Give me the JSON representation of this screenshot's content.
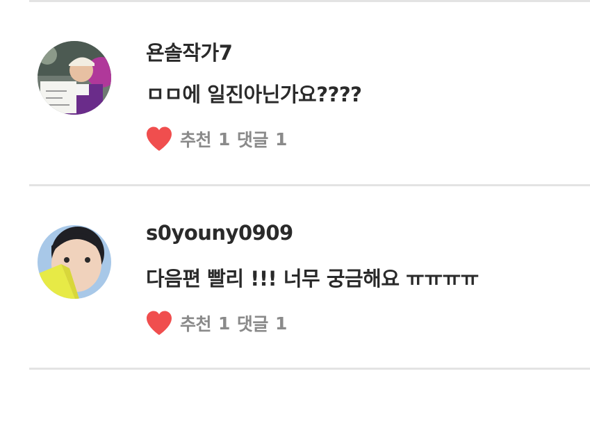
{
  "comments": [
    {
      "username": "욘솔작가7",
      "text": "ㅁㅁ에 일진아닌가요????",
      "like_label": "추천",
      "like_count": "1",
      "reply_label": "댓글",
      "reply_count": "1",
      "avatar_icon": "user-avatar-photo"
    },
    {
      "username": "s0youny0909",
      "text": "다음편 빨리 !!! 너무 궁금해요 ㅠㅠㅠㅠ",
      "like_label": "추천",
      "like_count": "1",
      "reply_label": "댓글",
      "reply_count": "1",
      "avatar_icon": "user-avatar-photo"
    }
  ],
  "colors": {
    "heart": "#f04e4e",
    "meta_text": "#8a8a8a",
    "divider": "#e3e3e3"
  }
}
